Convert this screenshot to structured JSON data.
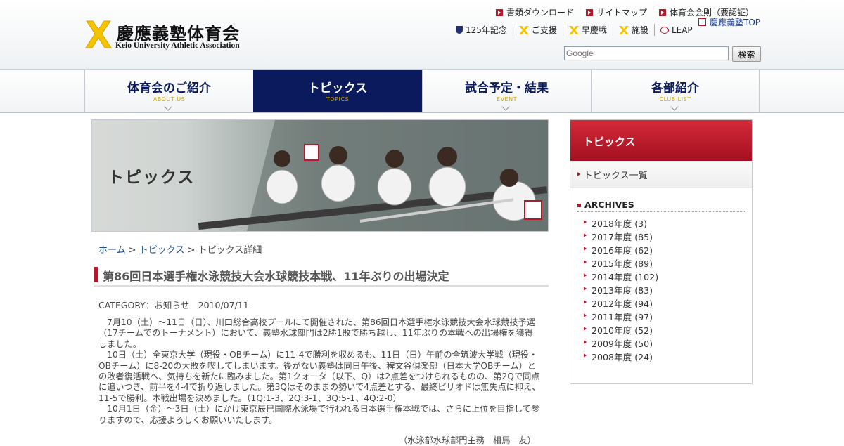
{
  "header": {
    "logo_title": "慶應義塾体育会",
    "logo_sub": "Keio University Athletic Association",
    "top_links": [
      "書類ダウンロード",
      "サイトマップ",
      "体育会会則（要認証）"
    ],
    "sub_links": [
      "125年記念",
      "ご支援",
      "早慶戦",
      "施設",
      "LEAP"
    ],
    "keio_top": "慶應義塾TOP",
    "search_placeholder": "Google",
    "search_button": "検索"
  },
  "nav": [
    {
      "label": "体育会のご紹介",
      "sub": "ABOUT US"
    },
    {
      "label": "トピックス",
      "sub": "TOPICS"
    },
    {
      "label": "試合予定・結果",
      "sub": "EVENT"
    },
    {
      "label": "各部紹介",
      "sub": "CLUB LIST"
    }
  ],
  "hero": {
    "title": "トピックス"
  },
  "breadcrumb": {
    "home": "ホーム",
    "sep": " > ",
    "topics": "トピックス",
    "current": "トピックス詳細"
  },
  "article": {
    "title": "第86回日本選手権水泳競技大会水球競技本戦、11年ぶりの出場決定",
    "meta": "CATEGORY：お知らせ　2010/07/11",
    "p1": "　7月10（土）～11日（日）、川口総合高校プールにて開催された、第86回日本選手権水泳競技大会水球競技予選（17チームでのトーナメント）において、義塾水球部門は2勝1敗で勝ち越し、11年ぶりの本戦への出場権を獲得しました。",
    "p2": "　10日（土）全東京大学（現役・OBチーム）に11-4で勝利を収めるも、11日（日）午前の全筑波大学戦（現役・OBチーム）に8-20の大敗を喫してしまいます。後がない義塾は同日午後、稗文谷倶楽部（日本大学OBチーム）との敗者復活戦へ、気持ちを新たに臨みました。第1クォータ（以下、Q）は2点差をつけられるものの、第2Qで同点に追いつき、前半を4-4で折り返しました。第3Qはそのままの勢いで4点差とする、最終ピリオドは無失点に抑え、11-5で勝利。本戦出場を決めました。（1Q:1-3、2Q:3-1、3Q:5-1、4Q:2-0）",
    "p3": "　10月1日（金）～3日（土）にかけ東京辰巳国際水泳場で行われる日本選手権本戦では、さらに上位を目指して参りますので、応援よろしくお願いいたします。",
    "signature": "（水泳部水球部門主務　相馬一友）"
  },
  "sidebar": {
    "title": "トピックス",
    "list_link": "トピックス一覧",
    "archives_title": "ARCHIVES",
    "archives": [
      "2018年度 (3)",
      "2017年度 (85)",
      "2016年度 (62)",
      "2015年度 (89)",
      "2014年度 (102)",
      "2013年度 (83)",
      "2012年度 (94)",
      "2011年度 (97)",
      "2010年度 (52)",
      "2009年度 (50)",
      "2008年度 (24)"
    ]
  },
  "colors": {
    "navy": "#0a1a5c",
    "red": "#b5172b",
    "gold": "#f5c400"
  }
}
